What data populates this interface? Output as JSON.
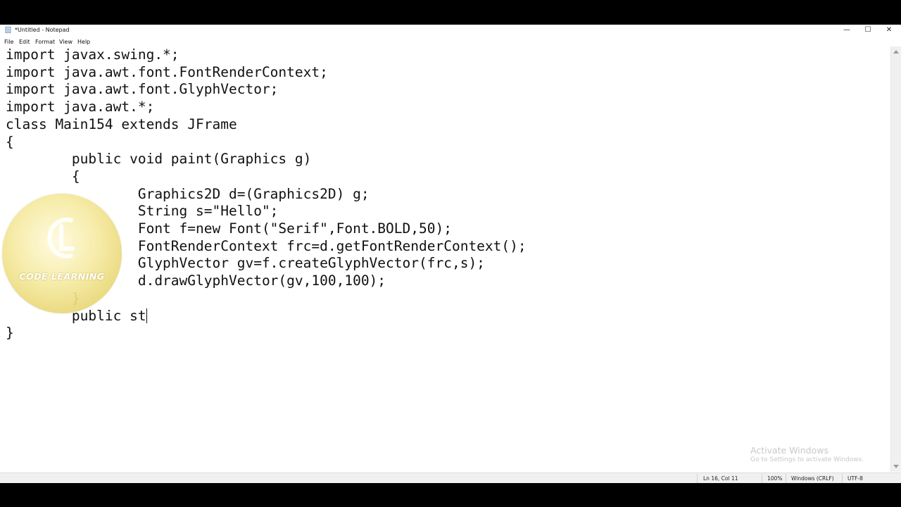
{
  "window": {
    "title": "*Untitled - Notepad",
    "controls": {
      "minimize": "—",
      "maximize": "☐",
      "close": "✕"
    }
  },
  "menu": {
    "file": "File",
    "edit": "Edit",
    "format": "Format",
    "view": "View",
    "help": "Help"
  },
  "editor": {
    "lines": [
      "import javax.swing.*;",
      "import java.awt.font.FontRenderContext;",
      "import java.awt.font.GlyphVector;",
      "import java.awt.*;",
      "class Main154 extends JFrame",
      "{",
      "        public void paint(Graphics g)",
      "        {",
      "                Graphics2D d=(Graphics2D) g;",
      "                String s=\"Hello\";",
      "                Font f=new Font(\"Serif\",Font.BOLD,50);",
      "                FontRenderContext frc=d.getFontRenderContext();",
      "                GlyphVector gv=f.createGlyphVector(frc,s);",
      "                d.drawGlyphVector(gv,100,100);",
      "        }",
      "        public st",
      "}"
    ]
  },
  "status": {
    "position": "Ln 16, Col 11",
    "zoom": "100%",
    "line_ending": "Windows (CRLF)",
    "encoding": "UTF-8"
  },
  "activation": {
    "title": "Activate Windows",
    "subtitle": "Go to Settings to activate Windows."
  },
  "logo": {
    "text": "CODE LEARNING"
  }
}
